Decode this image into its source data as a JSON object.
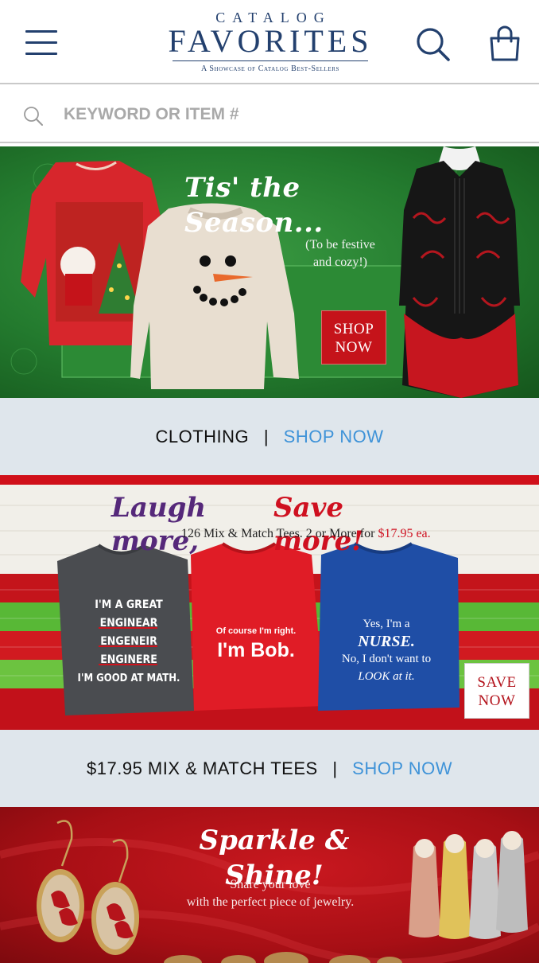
{
  "header": {
    "logo_top": "Catalog",
    "logo_main": "FAVORITES",
    "logo_tagline": "A Showcase of Catalog Best-Sellers",
    "menu_icon": "hamburger-menu-icon",
    "search_icon": "search-icon",
    "bag_icon": "shopping-bag-icon"
  },
  "search": {
    "placeholder": "KEYWORD OR ITEM #",
    "value": ""
  },
  "banners": [
    {
      "headline": "Tis' the Season...",
      "subtext_1": "(To be festive",
      "subtext_2": "and cozy!)",
      "cta_1": "SHOP",
      "cta_2": "NOW",
      "strip_label": "CLOTHING",
      "strip_sep": "|",
      "strip_link": "SHOP NOW"
    },
    {
      "headline_1": "Laugh more,",
      "headline_2": "Save more!",
      "subtext": "126 Mix & Match Tees. 2 or More for",
      "price": "$17.95 ea.",
      "tee1_lines": [
        "I'M A GREAT",
        "ENGINEAR",
        "ENGENEIR",
        "ENGINERE",
        "I'M GOOD AT MATH."
      ],
      "tee2_line1": "Of course I'm right.",
      "tee2_line2": "I'm Bob.",
      "tee3_line1": "Yes, I'm a",
      "tee3_line2": "NURSE.",
      "tee3_line3": "No, I don't want to",
      "tee3_line4": "LOOK at it.",
      "cta_1": "SAVE",
      "cta_2": "NOW",
      "strip_label": "$17.95 MIX & MATCH TEES",
      "strip_sep": "|",
      "strip_link": "SHOP NOW"
    },
    {
      "headline": "Sparkle & Shine!",
      "subtext_1": "Share your love",
      "subtext_2": "with the perfect piece of jewelry."
    }
  ],
  "colors": {
    "brand_navy": "#23406e",
    "link_blue": "#3f93d8",
    "strip_bg": "#dfe6ec",
    "christmas_red": "#c5131a",
    "christmas_green": "#2a8535"
  }
}
